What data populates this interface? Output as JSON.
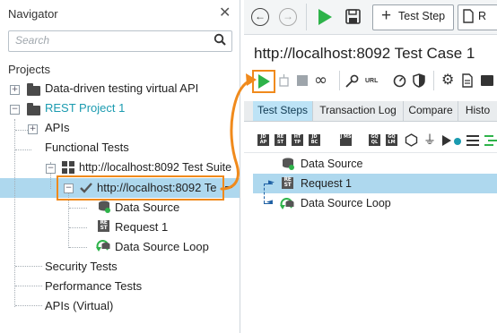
{
  "navigator": {
    "title": "Navigator",
    "search_placeholder": "Search",
    "projects_label": "Projects",
    "tree": {
      "project1": "Data-driven testing virtual API",
      "project2": "REST Project 1",
      "apis": "APIs",
      "functional_tests": "Functional Tests",
      "suite": "http://localhost:8092 Test Suite",
      "test_case": "http://localhost:8092 Te",
      "steps": [
        "Data Source",
        "Request 1",
        "Data Source Loop"
      ],
      "security_tests": "Security Tests",
      "performance_tests": "Performance Tests",
      "apis_virtual": "APIs (Virtual)"
    }
  },
  "toolbar": {
    "test_step_button": "Test Step",
    "re_button": "R"
  },
  "editor": {
    "title": "http://localhost:8092 Test Case 1",
    "url_icon_label": "URL",
    "tabs": [
      "Test Steps",
      "Transaction Log",
      "Compare",
      "Histo"
    ],
    "steps": [
      "Data Source",
      "Request 1",
      "Data Source Loop"
    ],
    "icon_labels": [
      "JD AP",
      "RE ST",
      "HT TP",
      "JD BC",
      "J MS",
      "GQ QL",
      "GQ LM"
    ]
  },
  "colors": {
    "accent_orange": "#f08a1c",
    "selection_blue": "#aed8ee",
    "run_green": "#2eb34a",
    "project_teal": "#1b9bb0"
  }
}
